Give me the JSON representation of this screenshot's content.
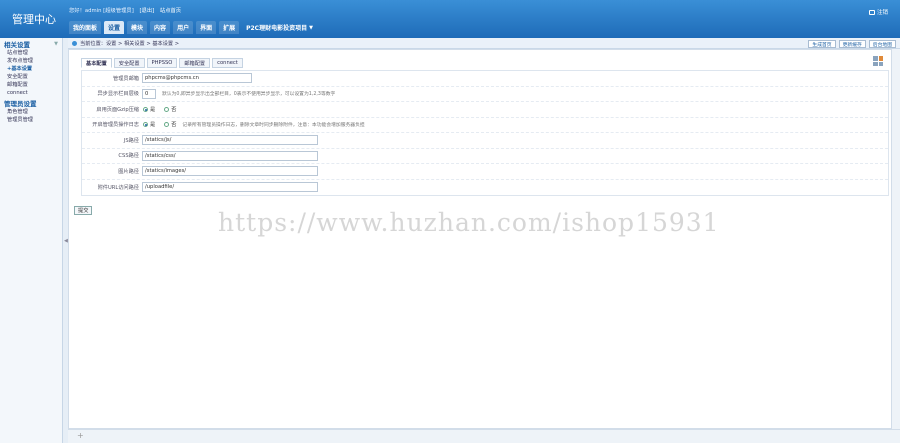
{
  "brand": "管理中心",
  "toplinks": {
    "greeting": "您好！admin [超级管理员]",
    "logout": "[退出]",
    "site_home": "站点首页"
  },
  "nav": [
    "我的面板",
    "设置",
    "模块",
    "内容",
    "用户",
    "界面",
    "扩展"
  ],
  "nav_project": "P2C理财电影投资项目",
  "exit_label": "注销",
  "sidebar": {
    "group1": {
      "title": "相关设置",
      "items": [
        "站点管理",
        "发布点管理",
        "+基本设置",
        "安全配置",
        "邮箱配置",
        "connect"
      ]
    },
    "group2": {
      "title": "管理员设置",
      "items": [
        "角色管理",
        "管理员管理"
      ]
    }
  },
  "breadcrumb": "当前位置：设置 > 相关设置 > 基本设置 >",
  "quick_buttons": [
    "生成首页",
    "更新缓存",
    "后台地图"
  ],
  "tabs": [
    "基本配置",
    "安全配置",
    "PHPSSO",
    "邮箱配置",
    "connect"
  ],
  "form": {
    "admin_email": {
      "label": "管理员邮箱",
      "value": "phpcms@phpcms.cn"
    },
    "category_ajax": {
      "label": "异步显示栏目层级",
      "value": "0",
      "hint": "默认为0,即异步显示出全部栏目，0表示不使用异步显示，可以设置为1,2,3等数字"
    },
    "gzip": {
      "label": "启用页面Gzip压缩",
      "yes": "是",
      "no": "否"
    },
    "log": {
      "label": "开启管理员操作日志",
      "yes": "是",
      "no": "否",
      "hint": "记录所有管理员操作日志，删除文章时同步删除附件，注意：本功能会增加服务器负担"
    },
    "js_path": {
      "label": "JS路径",
      "value": "/statics/js/"
    },
    "css_path": {
      "label": "CSS路径",
      "value": "/statics/css/"
    },
    "img_path": {
      "label": "图片路径",
      "value": "/statics/images/"
    },
    "upload_url": {
      "label": "附件URL访问路径",
      "value": "/uploadfile/"
    }
  },
  "submit_label": "提交",
  "watermark": "https://www.huzhan.com/ishop15931"
}
